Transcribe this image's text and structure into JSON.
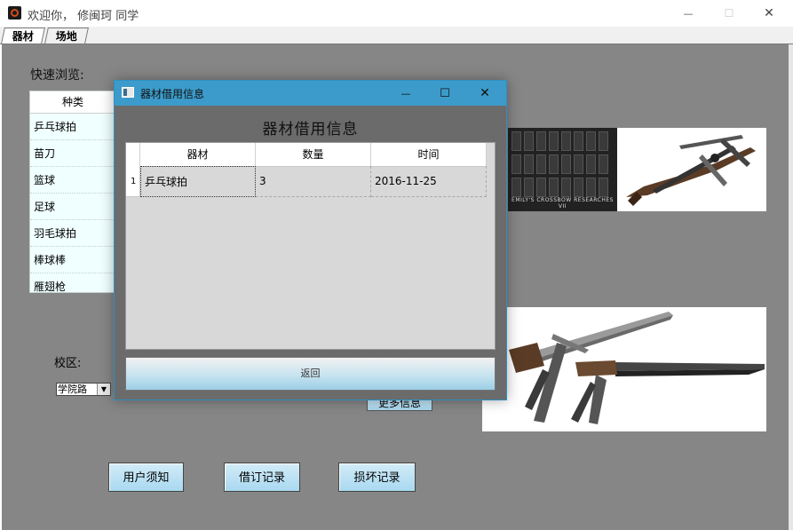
{
  "window": {
    "title": "欢迎你， 修闽珂 同学",
    "minimize_glyph": "—",
    "maximize_glyph": "☐",
    "close_glyph": "✕"
  },
  "tabs": [
    {
      "label": "器材"
    },
    {
      "label": "场地"
    }
  ],
  "main": {
    "quick_browse_label": "快速浏览:",
    "category_table": {
      "header": "种类",
      "rows": [
        "乒乓球拍",
        "苗刀",
        "篮球",
        "足球",
        "羽毛球拍",
        "棒球棒",
        "雁翅枪"
      ]
    },
    "campus_label": "校区:",
    "campus_select": {
      "value": "学院路"
    },
    "more_info_button": "更多信息",
    "image_caption": "EMILY'S CROSSBOW RESEARCHES VII",
    "buttons": {
      "user_notice": "用户须知",
      "booking_records": "借订记录",
      "damage_records": "损坏记录"
    }
  },
  "dialog": {
    "title": "器材借用信息",
    "heading": "器材借用信息",
    "minimize_glyph": "—",
    "maximize_glyph": "☐",
    "close_glyph": "✕",
    "table": {
      "columns": [
        "器材",
        "数量",
        "时间"
      ],
      "rows": [
        {
          "index": "1",
          "item": "乒乓球拍",
          "quantity": "3",
          "time": "2016-11-25"
        }
      ]
    },
    "return_button": "返回"
  },
  "colors": {
    "dialog_titlebar": "#3c9bca",
    "content_bg": "#868686",
    "button_gradient_bottom": "#a8d8f0"
  }
}
